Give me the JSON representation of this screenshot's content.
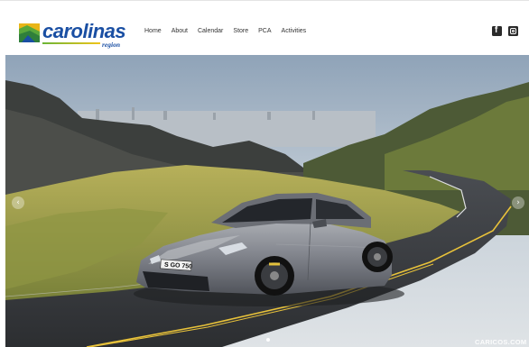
{
  "brand": {
    "name": "carolinas",
    "subtitle": "region"
  },
  "nav": {
    "items": [
      "Home",
      "About",
      "Calendar",
      "Store",
      "PCA",
      "Activities"
    ]
  },
  "social": {
    "facebook_glyph": "f",
    "icons": [
      "facebook-icon",
      "instagram-icon"
    ]
  },
  "hero": {
    "slide_count": 1,
    "active_slide": 1,
    "plate_text": "S GO 750",
    "watermark": "CARICOS.COM",
    "prev_glyph": "‹",
    "next_glyph": "›"
  },
  "colors": {
    "brand_blue": "#1a4fa3",
    "brand_green": "#6bb536",
    "car_gray": "#7d8088"
  }
}
